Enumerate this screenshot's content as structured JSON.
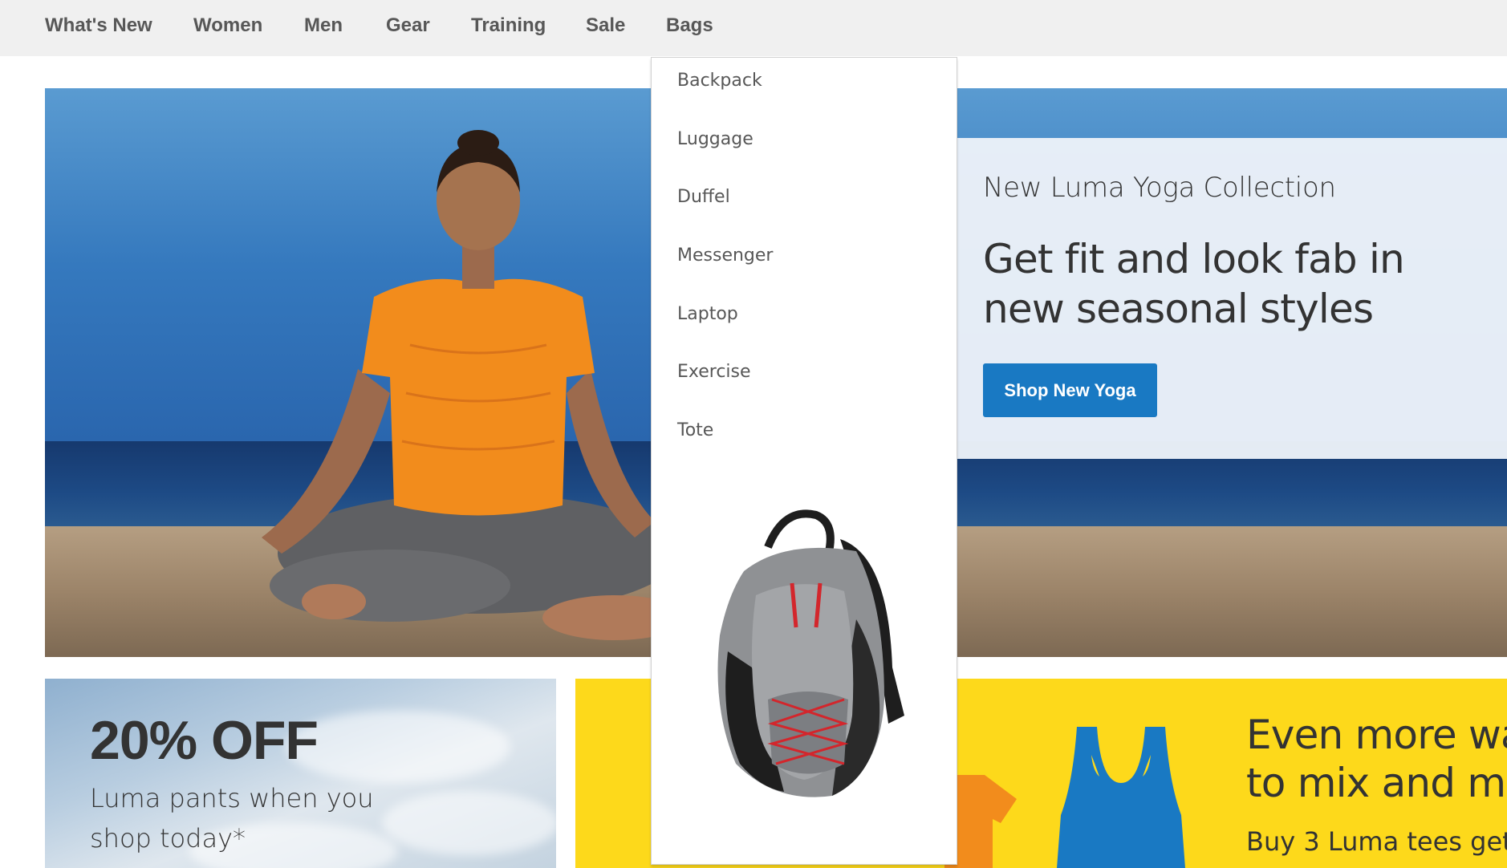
{
  "nav": {
    "items": [
      "What's New",
      "Women",
      "Men",
      "Gear",
      "Training",
      "Sale",
      "Bags"
    ]
  },
  "hero": {
    "eyebrow": "New Luma Yoga Collection",
    "headline": "Get fit and look fab in new seasonal styles",
    "button_label": "Shop New Yoga",
    "button_color": "#1979c3"
  },
  "dropdown": {
    "parent": "Bags",
    "items": [
      "Backpack",
      "Luggage",
      "Duffel",
      "Messenger",
      "Laptop",
      "Exercise",
      "Tote"
    ],
    "image_icon": "backpack-product-image"
  },
  "promo_sale": {
    "title": "20% OFF",
    "subtitle": "Luma pants when you shop today*"
  },
  "promo_tees": {
    "title_line1": "Even more way",
    "title_line2": "to mix and ma",
    "subtitle": "Buy 3 Luma tees get",
    "background_color": "#fdd91b"
  }
}
